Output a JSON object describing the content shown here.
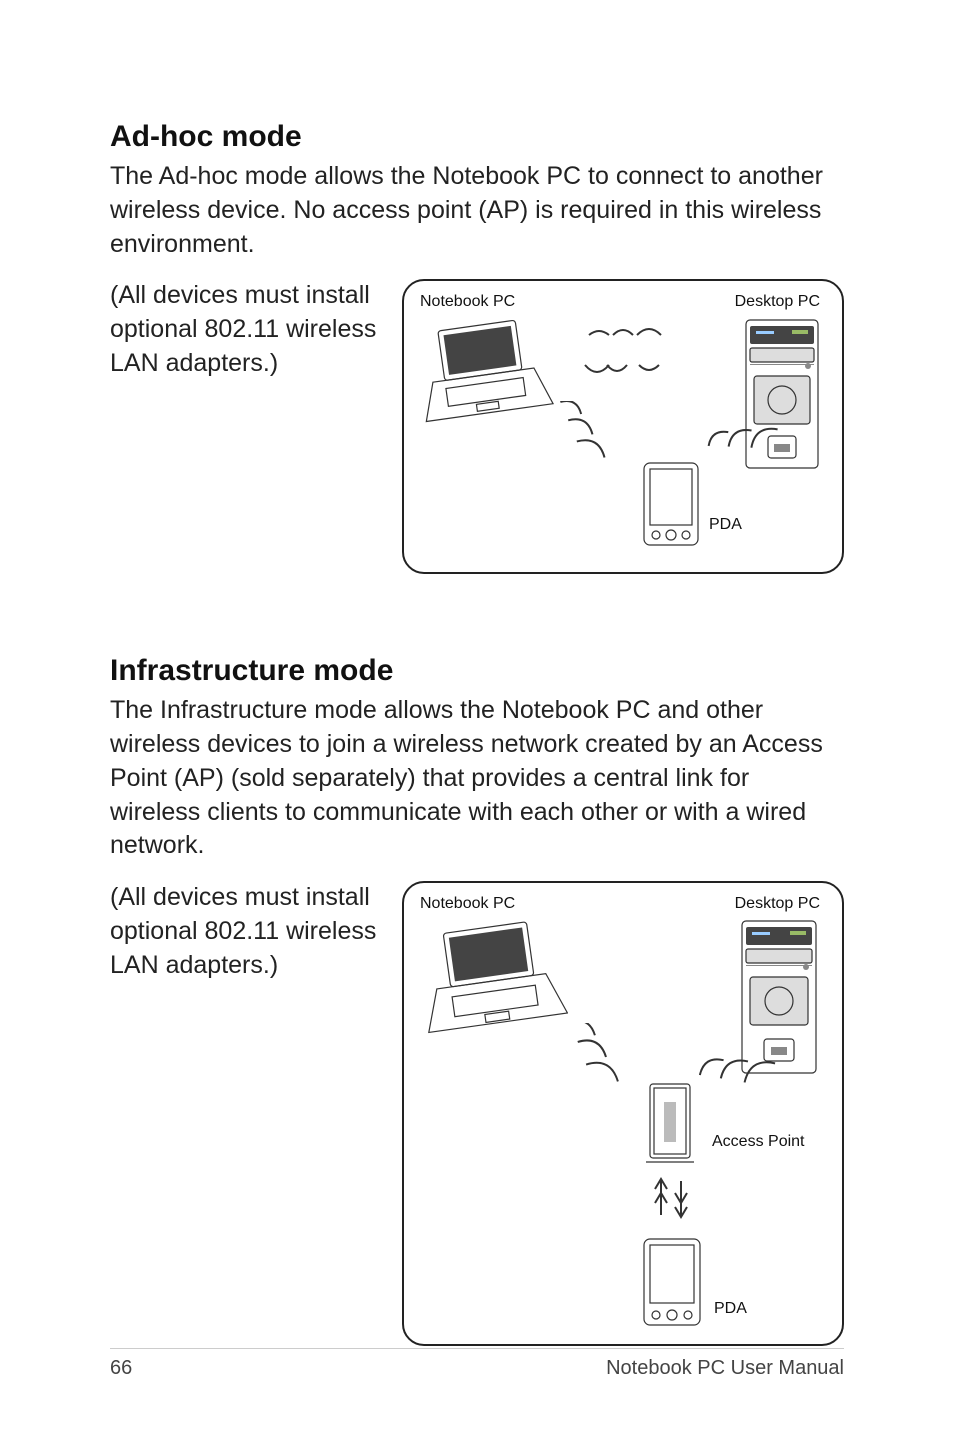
{
  "section1": {
    "heading": "Ad-hoc mode",
    "paragraph": "The Ad-hoc mode allows the Notebook PC to connect to another wireless device. No access point (AP) is required in this wireless environment.",
    "side_text": "(All devices must install optional 802.11 wireless LAN adapters.)",
    "labels": {
      "notebook": "Notebook PC",
      "desktop": "Desktop PC",
      "pda": "PDA"
    }
  },
  "section2": {
    "heading": "Infrastructure mode",
    "paragraph": "The Infrastructure mode allows the Notebook PC and other wireless devices to join a wireless network created by an Access Point (AP) (sold separately) that provides a central link for wireless clients to communicate with each other or with a wired network.",
    "side_text": "(All devices must install optional 802.11 wireless LAN adapters.)",
    "labels": {
      "notebook": "Notebook PC",
      "desktop": "Desktop PC",
      "pda": "PDA",
      "access_point": "Access Point"
    }
  },
  "footer": {
    "page": "66",
    "title": "Notebook PC User Manual"
  }
}
